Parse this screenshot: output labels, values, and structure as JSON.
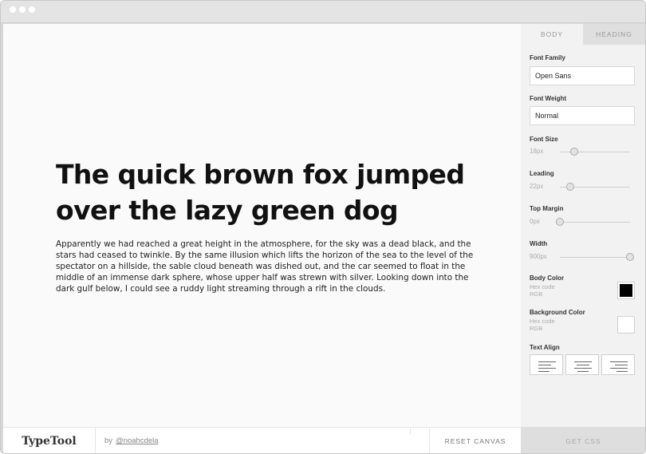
{
  "canvas": {
    "headline": "The quick brown fox jumped over the lazy green dog",
    "paragraph": "Apparently we had reached a great height in the atmosphere, for the sky was a dead black, and the stars had ceased to twinkle. By the same illusion which lifts the horizon of the sea to the level of the spectator on a hillside, the sable cloud beneath was dished out, and the car seemed to float in the middle of an immense dark sphere, whose upper half was strewn with silver. Looking down into the dark gulf below, I could see a ruddy light streaming through a rift in the clouds."
  },
  "sidebar": {
    "tabs": [
      {
        "label": "BODY",
        "active": true
      },
      {
        "label": "HEADING",
        "active": false
      }
    ],
    "font_family": {
      "label": "Font Family",
      "value": "Open Sans"
    },
    "font_weight": {
      "label": "Font Weight",
      "value": "Normal"
    },
    "font_size": {
      "label": "Font Size",
      "value": "18px",
      "level": 0.2
    },
    "leading": {
      "label": "Leading",
      "value": "22px",
      "level": 0.15
    },
    "top_margin": {
      "label": "Top Margin",
      "value": "0px",
      "level": 0.0
    },
    "width": {
      "label": "Width",
      "value": "900px",
      "level": 1.0
    },
    "body_color": {
      "label": "Body Color",
      "hex_label": "Hex code",
      "rgb_label": "RGB",
      "color": "#000000"
    },
    "background_color": {
      "label": "Background Color",
      "hex_label": "Hex code",
      "rgb_label": "RGB",
      "color": "#ffffff"
    },
    "text_align": {
      "label": "Text Align",
      "options": [
        "left-align-icon",
        "center-align-icon",
        "right-align-icon"
      ]
    }
  },
  "footer": {
    "logo": "TypeTool",
    "by": "by",
    "author": "@noahcdela",
    "reset_label": "RESET CANVAS",
    "get_css_label": "GET CSS"
  }
}
